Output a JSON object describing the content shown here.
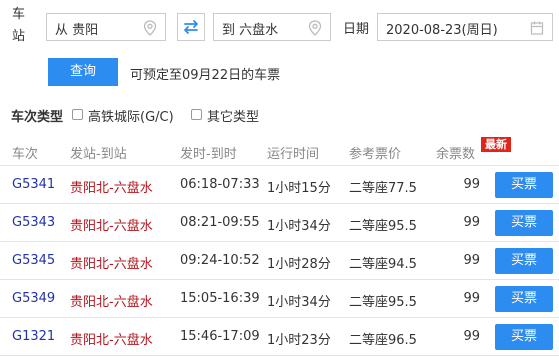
{
  "search": {
    "label_char1": "车",
    "label_char2": "站",
    "from_value": "从 贵阳",
    "to_value": "到 六盘水",
    "date_label": "日期",
    "date_value": "2020-08-23(周日)",
    "query_button": "查询",
    "presale_note": "可预定至09月22日的车票"
  },
  "filters": {
    "title": "车次类型",
    "options": [
      {
        "label": "高铁城际(G/C)"
      },
      {
        "label": "其它类型"
      }
    ]
  },
  "table": {
    "headers": [
      "车次",
      "发站-到站",
      "发时-到时",
      "运行时间",
      "参考票价",
      "余票数"
    ],
    "new_badge": "最新",
    "buy_label": "买票",
    "rows": [
      {
        "train": "G5341",
        "route": "贵阳北-六盘水",
        "time": "06:18-07:33",
        "duration": "1小时15分",
        "price": "二等座77.5",
        "left": "99"
      },
      {
        "train": "G5343",
        "route": "贵阳北-六盘水",
        "time": "08:21-09:55",
        "duration": "1小时34分",
        "price": "二等座95.5",
        "left": "99"
      },
      {
        "train": "G5345",
        "route": "贵阳北-六盘水",
        "time": "09:24-10:52",
        "duration": "1小时28分",
        "price": "二等座94.5",
        "left": "99"
      },
      {
        "train": "G5349",
        "route": "贵阳北-六盘水",
        "time": "15:05-16:39",
        "duration": "1小时34分",
        "price": "二等座95.5",
        "left": "99"
      },
      {
        "train": "G1321",
        "route": "贵阳北-六盘水",
        "time": "15:46-17:09",
        "duration": "1小时23分",
        "price": "二等座96.5",
        "left": "99"
      }
    ]
  },
  "colors": {
    "accent": "#2d8cf0",
    "route": "#b3161d",
    "train": "#2233aa",
    "badge": "#e1251b"
  }
}
